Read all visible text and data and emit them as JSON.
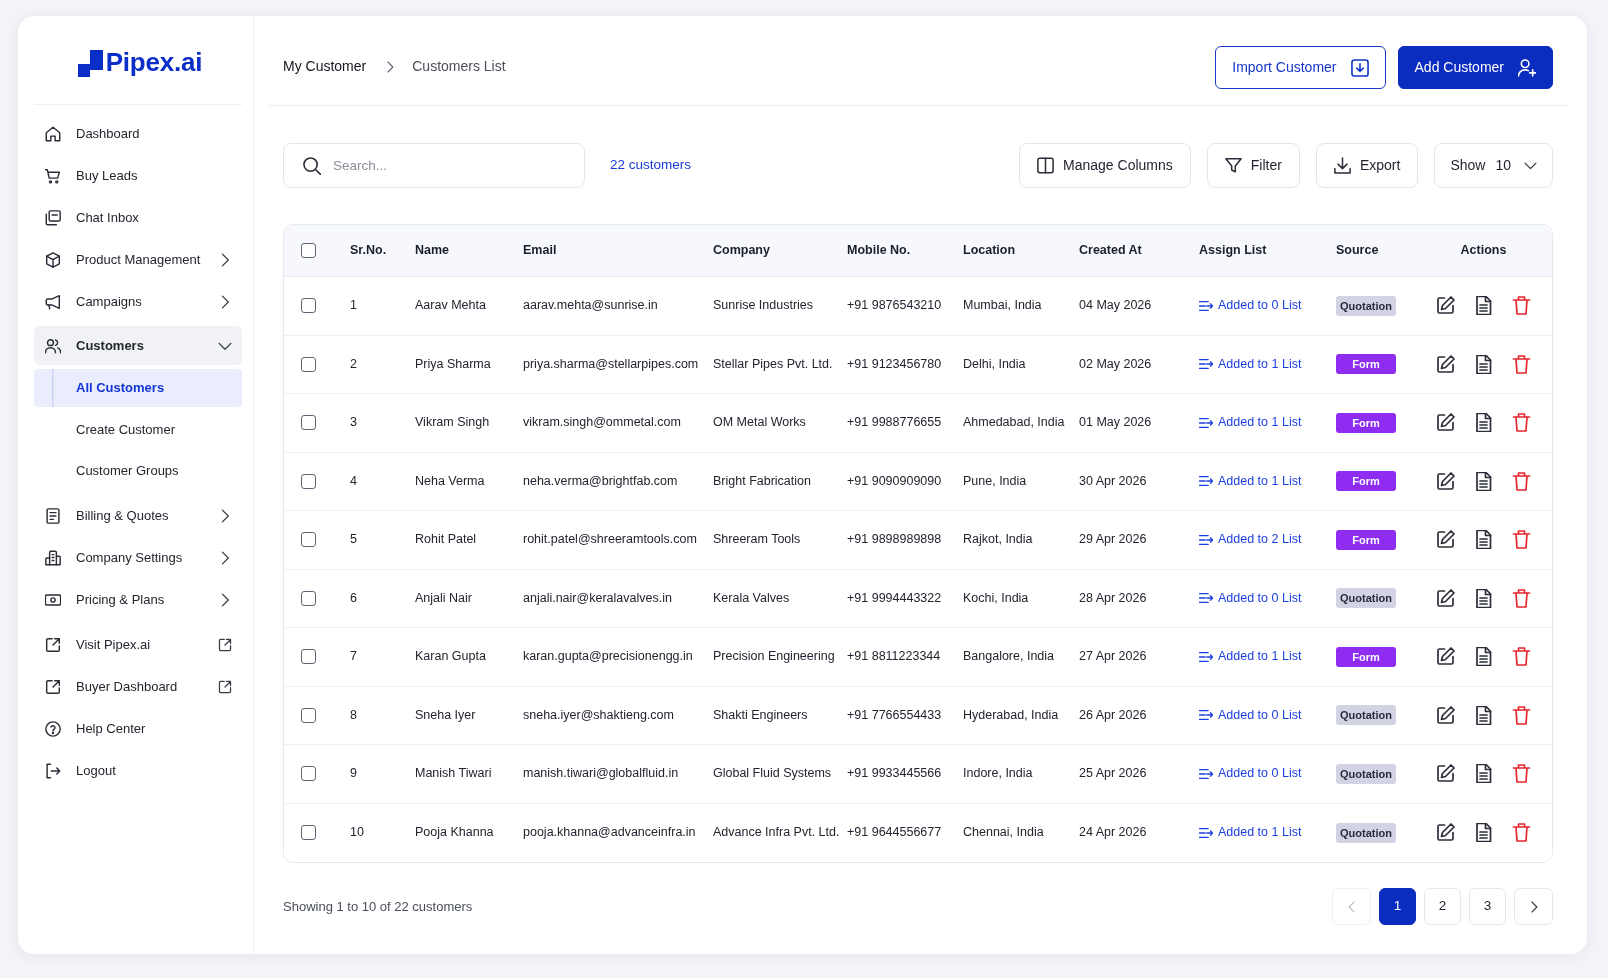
{
  "logo": {
    "text": "Pipex.ai"
  },
  "sidebar": {
    "items": [
      {
        "label": "Dashboard",
        "kind": "link",
        "selected": false
      },
      {
        "label": "Buy Leads",
        "kind": "link",
        "selected": false
      },
      {
        "label": "Chat Inbox",
        "kind": "link",
        "selected": false
      },
      {
        "label": "Product Management",
        "kind": "group",
        "selected": false,
        "expanded": false
      },
      {
        "label": "Campaigns",
        "kind": "group",
        "selected": false,
        "expanded": false
      },
      {
        "label": "Customers",
        "kind": "group",
        "selected": true,
        "expanded": true,
        "children": [
          {
            "label": "All Customers",
            "selected": true
          },
          {
            "label": "Create Customer",
            "selected": false
          },
          {
            "label": "Customer Groups",
            "selected": false
          }
        ]
      },
      {
        "label": "Billing & Quotes",
        "kind": "group",
        "selected": false,
        "expanded": false
      },
      {
        "label": "Company Settings",
        "kind": "group",
        "selected": false,
        "expanded": false
      },
      {
        "label": "Pricing & Plans",
        "kind": "group",
        "selected": false,
        "expanded": false
      },
      {
        "label": "Visit Pipex.ai",
        "kind": "external",
        "selected": false
      },
      {
        "label": "Buyer Dashboard",
        "kind": "external",
        "selected": false
      },
      {
        "label": "Help Center",
        "kind": "link",
        "selected": false
      },
      {
        "label": "Logout",
        "kind": "link",
        "selected": false
      }
    ]
  },
  "breadcrumb": [
    {
      "label": "My Customer",
      "current": false
    },
    {
      "label": "Customers List",
      "current": true
    }
  ],
  "header_buttons": [
    {
      "label": "Import Customer",
      "kind": "outline"
    },
    {
      "label": "Add Customer",
      "kind": "solid"
    }
  ],
  "toolbar": {
    "search": {
      "placeholder": "Search..."
    },
    "count": "22 customers",
    "buttons": [
      {
        "label": "Manage Columns"
      },
      {
        "label": "Filter"
      },
      {
        "label": "Export"
      }
    ],
    "page_size": {
      "label": "Show",
      "value": "10"
    }
  },
  "table": {
    "select_all_checked": false,
    "columns": [
      "Sr.No.",
      "Name",
      "Email",
      "Company",
      "Mobile No.",
      "Location",
      "Created At",
      "Assign List",
      "Source",
      "Actions"
    ],
    "rows": [
      {
        "checked": false,
        "sr": "1",
        "name": "Aarav Mehta",
        "email": "aarav.mehta@sunrise.in",
        "company": "Sunrise Industries",
        "mobile": "+91 9876543210",
        "location": "Mumbai, India",
        "created_at": "04 May 2026",
        "assign_list": "Added to 0 List",
        "source": {
          "label": "Quotation",
          "kind": "quotation"
        }
      },
      {
        "checked": false,
        "sr": "2",
        "name": "Priya Sharma",
        "email": "priya.sharma@stellarpipes.com",
        "company": "Stellar Pipes Pvt. Ltd.",
        "mobile": "+91 9123456780",
        "location": "Delhi, India",
        "created_at": "02 May 2026",
        "assign_list": "Added to 1 List",
        "source": {
          "label": "Form",
          "kind": "form"
        }
      },
      {
        "checked": false,
        "sr": "3",
        "name": "Vikram Singh",
        "email": "vikram.singh@ommetal.com",
        "company": "OM Metal Works",
        "mobile": "+91 9988776655",
        "location": "Ahmedabad, India",
        "created_at": "01 May 2026",
        "assign_list": "Added to 1 List",
        "source": {
          "label": "Form",
          "kind": "form"
        }
      },
      {
        "checked": false,
        "sr": "4",
        "name": "Neha Verma",
        "email": "neha.verma@brightfab.com",
        "company": "Bright Fabrication",
        "mobile": "+91 9090909090",
        "location": "Pune, India",
        "created_at": "30 Apr 2026",
        "assign_list": "Added to 1 List",
        "source": {
          "label": "Form",
          "kind": "form"
        }
      },
      {
        "checked": false,
        "sr": "5",
        "name": "Rohit Patel",
        "email": "rohit.patel@shreeramtools.com",
        "company": "Shreeram Tools",
        "mobile": "+91 9898989898",
        "location": "Rajkot, India",
        "created_at": "29 Apr 2026",
        "assign_list": "Added to 2 List",
        "source": {
          "label": "Form",
          "kind": "form"
        }
      },
      {
        "checked": false,
        "sr": "6",
        "name": "Anjali Nair",
        "email": "anjali.nair@keralavalves.in",
        "company": "Kerala Valves",
        "mobile": "+91 9994443322",
        "location": "Kochi, India",
        "created_at": "28 Apr 2026",
        "assign_list": "Added to 0 List",
        "source": {
          "label": "Quotation",
          "kind": "quotation"
        }
      },
      {
        "checked": false,
        "sr": "7",
        "name": "Karan Gupta",
        "email": "karan.gupta@precisionengg.in",
        "company": "Precision Engineering",
        "mobile": "+91 8811223344",
        "location": "Bangalore, India",
        "created_at": "27 Apr 2026",
        "assign_list": "Added to 1 List",
        "source": {
          "label": "Form",
          "kind": "form"
        }
      },
      {
        "checked": false,
        "sr": "8",
        "name": "Sneha Iyer",
        "email": "sneha.iyer@shaktieng.com",
        "company": "Shakti Engineers",
        "mobile": "+91 7766554433",
        "location": "Hyderabad, India",
        "created_at": "26 Apr 2026",
        "assign_list": "Added to 0 List",
        "source": {
          "label": "Quotation",
          "kind": "quotation"
        }
      },
      {
        "checked": false,
        "sr": "9",
        "name": "Manish Tiwari",
        "email": "manish.tiwari@globalfluid.in",
        "company": "Global Fluid Systems",
        "mobile": "+91 9933445566",
        "location": "Indore, India",
        "created_at": "25 Apr 2026",
        "assign_list": "Added to 0 List",
        "source": {
          "label": "Quotation",
          "kind": "quotation"
        }
      },
      {
        "checked": false,
        "sr": "10",
        "name": "Pooja Khanna",
        "email": "pooja.khanna@advanceinfra.in",
        "company": "Advance Infra Pvt. Ltd.",
        "mobile": "+91 9644556677",
        "location": "Chennai, India",
        "created_at": "24 Apr 2026",
        "assign_list": "Added to 1 List",
        "source": {
          "label": "Quotation",
          "kind": "quotation"
        }
      }
    ]
  },
  "footer": {
    "summary": "Showing 1 to 10 of 22 customers",
    "pagination": {
      "previous": {
        "disabled": true
      },
      "pages": [
        {
          "label": "1",
          "selected": true
        },
        {
          "label": "2",
          "selected": false
        },
        {
          "label": "3",
          "selected": false
        }
      ],
      "next": {
        "disabled": false
      }
    }
  }
}
